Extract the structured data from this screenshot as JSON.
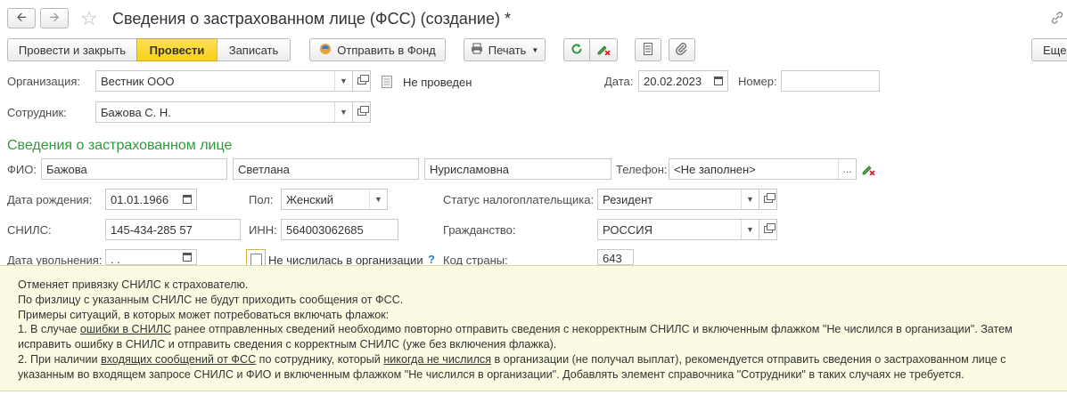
{
  "window": {
    "title": "Сведения о застрахованном лице (ФСС) (создание) *"
  },
  "toolbar": {
    "post_and_close": "Провести и закрыть",
    "post": "Провести",
    "save": "Записать",
    "send_to_fund": "Отправить в Фонд",
    "print": "Печать",
    "more": "Еще"
  },
  "header": {
    "org_label": "Организация:",
    "org_value": "Вестник ООО",
    "status": "Не проведен",
    "date_label": "Дата:",
    "date_value": "20.02.2023",
    "number_label": "Номер:",
    "number_value": "",
    "employee_label": "Сотрудник:",
    "employee_value": "Бажова С. Н."
  },
  "section": {
    "title": "Сведения о застрахованном лице",
    "fio_label": "ФИО:",
    "last_name": "Бажова",
    "first_name": "Светлана",
    "middle_name": "Нурисламовна",
    "phone_label": "Телефон:",
    "phone_value": "<Не заполнен>",
    "phone_btn": "...",
    "birth_label": "Дата рождения:",
    "birth_value": "01.01.1966",
    "sex_label": "Пол:",
    "sex_value": "Женский",
    "tax_status_label": "Статус налогоплательщика:",
    "tax_status_value": "Резидент",
    "snils_label": "СНИЛС:",
    "snils_value": "145-434-285 57",
    "inn_label": "ИНН:",
    "inn_value": "564003062685",
    "citizenship_label": "Гражданство:",
    "citizenship_value": "РОССИЯ",
    "dismissal_label": "Дата увольнения:",
    "dismissal_value": "  .  .",
    "not_listed_label": "Не числилась в организации",
    "help_mark": "?",
    "country_code_label": "Код страны:",
    "country_code_value": "643"
  },
  "tooltip": {
    "line1": "Отменяет привязку СНИЛС к страхователю.",
    "line2": "По физлицу с указанным СНИЛС не будут приходить сообщения от ФСС.",
    "line3": "Примеры ситуаций, в которых может потребоваться включать флажок:",
    "line4_a": "1. В случае ",
    "line4_link": "ошибки в СНИЛС",
    "line4_b": " ранее отправленных сведений необходимо повторно отправить сведения с некорректным СНИЛС и включенным флажком \"Не числился в организации\". Затем",
    "line5": "исправить ошибку в СНИЛС и отправить сведения с корректным СНИЛС (уже без включения флажка).",
    "line6_a": "2. При наличии ",
    "line6_link1": "входящих сообщений от ФСС",
    "line6_b": " по сотруднику, который ",
    "line6_link2": "никогда не числился",
    "line6_c": " в организации (не получал выплат), рекомендуется отправить сведения о застрахованном лице с",
    "line7": "указанным во входящем запросе СНИЛС и ФИО и включенным флажком \"Не числился в организации\". Добавлять элемент справочника \"Сотрудники\" в таких случаях не требуется."
  }
}
